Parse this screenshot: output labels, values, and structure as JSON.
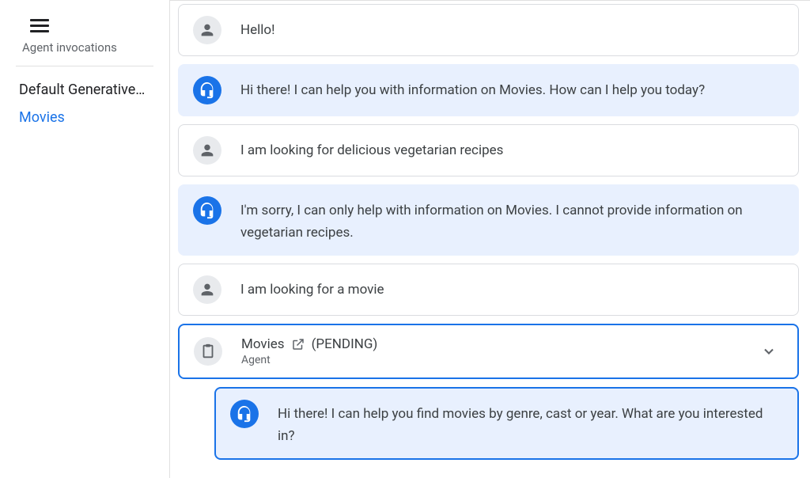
{
  "sidebar": {
    "title": "Agent invocations",
    "items": [
      {
        "label": "Default Generative…",
        "active": false
      },
      {
        "label": "Movies",
        "active": true
      }
    ]
  },
  "conversation": {
    "messages": [
      {
        "role": "user",
        "text": "Hello!"
      },
      {
        "role": "agent",
        "text": "Hi there! I can help you with information on Movies. How can I help you today?"
      },
      {
        "role": "user",
        "text": "I am looking for delicious vegetarian recipes"
      },
      {
        "role": "agent",
        "text": "I'm sorry, I can only help with information on Movies. I cannot provide information on vegetarian recipes."
      },
      {
        "role": "user",
        "text": "I am looking for a movie"
      }
    ],
    "tool_call": {
      "name": "Movies",
      "status": "(PENDING)",
      "subtitle": "Agent"
    },
    "nested_message": {
      "text": "Hi there! I can help you find movies by genre, cast or year. What are you interested in?"
    }
  }
}
